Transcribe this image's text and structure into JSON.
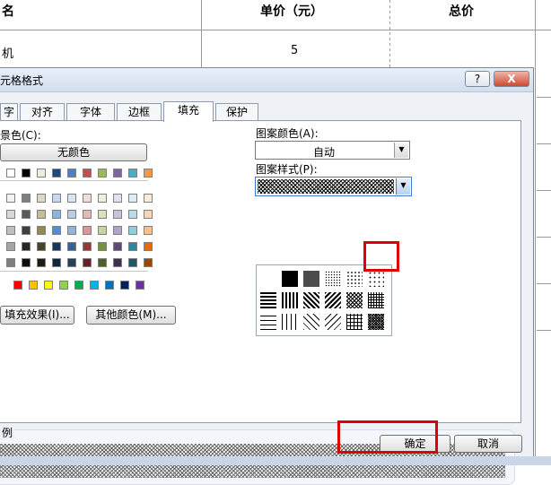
{
  "sheet": {
    "headers": [
      "名",
      "单价（元）",
      "总价"
    ],
    "row1": [
      "机",
      "5"
    ]
  },
  "dialog": {
    "title": "元格格式",
    "help_label": "?",
    "close_label": "X",
    "tabs": [
      "字",
      "对齐",
      "字体",
      "边框",
      "填充",
      "保护"
    ],
    "active_tab": "填充",
    "bg_color_label": "景色(C):",
    "no_color_label": "无颜色",
    "pattern_color_label": "图案颜色(A):",
    "pattern_color_value": "自动",
    "pattern_style_label": "图案样式(P):",
    "fill_effects_label": "填充效果(I)...",
    "more_colors_label": "其他颜色(M)...",
    "sample_label": "例",
    "ok_label": "确定",
    "cancel_label": "取消"
  },
  "colors": {
    "row1": [
      "#000000",
      "#ffffff",
      "#000000",
      "#eeece1",
      "#1f497d",
      "#4f81bd",
      "#c0504d",
      "#9bbb59",
      "#8064a2",
      "#4bacc6",
      "#f79646"
    ],
    "theme_rows": [
      [
        "#7f7f7f",
        "#f2f2f2",
        "#7f7f7f",
        "#ddd9c3",
        "#c6d9f0",
        "#dbe5f1",
        "#f2dcdb",
        "#ebf1dd",
        "#e5e0ec",
        "#dbeef3",
        "#fdeada"
      ],
      [
        "#595959",
        "#d8d8d8",
        "#595959",
        "#c4bd97",
        "#8db3e2",
        "#b8cce4",
        "#e5b9b7",
        "#d7e3bc",
        "#ccc1d9",
        "#b7dde8",
        "#fbd5b5"
      ],
      [
        "#3f3f3f",
        "#bfbfbf",
        "#3f3f3f",
        "#938953",
        "#548dd4",
        "#95b3d7",
        "#d99694",
        "#c3d69b",
        "#b2a2c7",
        "#92cddc",
        "#fac08f"
      ],
      [
        "#262626",
        "#a5a5a5",
        "#262626",
        "#494429",
        "#17365d",
        "#366092",
        "#953734",
        "#76923c",
        "#5f497a",
        "#31859b",
        "#e36c09"
      ],
      [
        "#0c0c0c",
        "#7f7f7f",
        "#0c0c0c",
        "#1d1b10",
        "#0f243e",
        "#244061",
        "#632423",
        "#4f6128",
        "#3f3151",
        "#205867",
        "#974806"
      ]
    ],
    "standard": [
      "#c00000",
      "#ff0000",
      "#ffc000",
      "#ffff00",
      "#92d050",
      "#00b050",
      "#00b0f0",
      "#0070c0",
      "#002060",
      "#7030a0"
    ],
    "highlight": "#e10000"
  }
}
